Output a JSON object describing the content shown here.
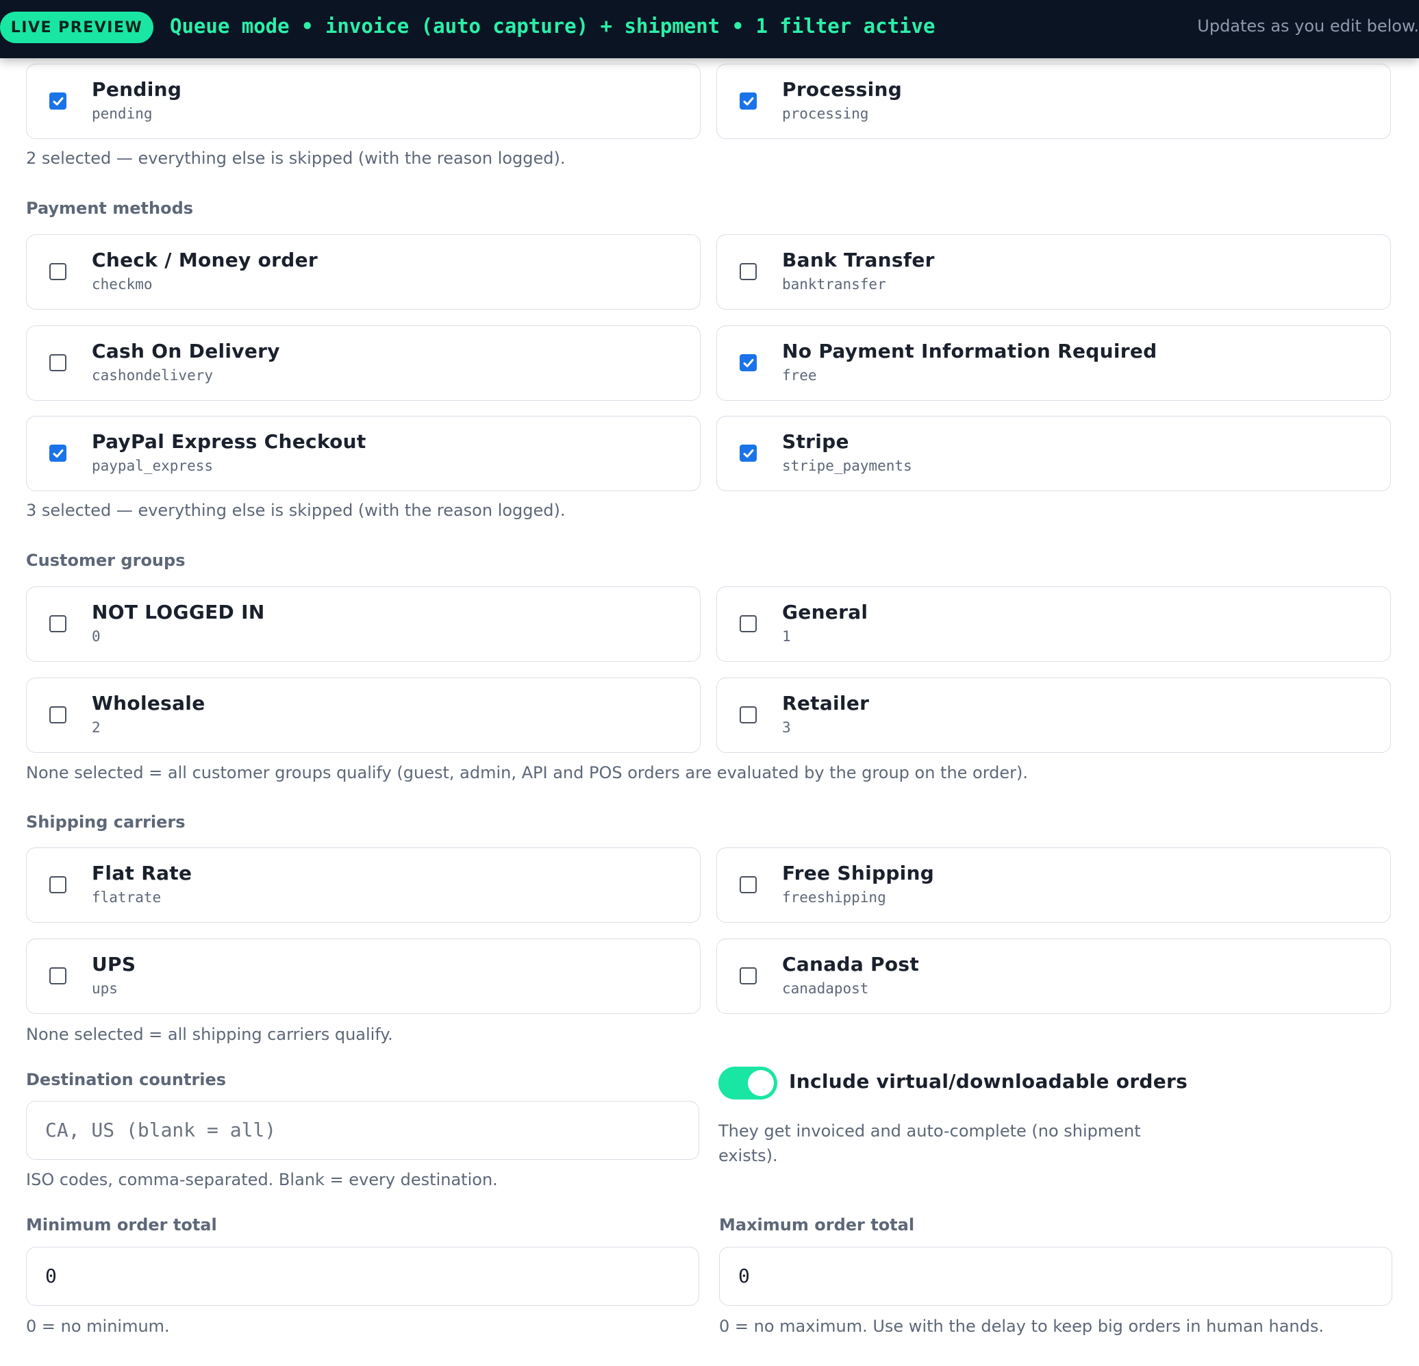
{
  "topbar": {
    "badge": "LIVE PREVIEW",
    "mode_summary": "Queue mode • invoice (auto capture) + shipment • 1 filter active",
    "updates_note": "Updates as you edit below."
  },
  "order_statuses": {
    "items": [
      {
        "title": "Pending",
        "code": "pending",
        "checked": true
      },
      {
        "title": "Processing",
        "code": "processing",
        "checked": true
      }
    ],
    "note": "2 selected — everything else is skipped (with the reason logged)."
  },
  "payment_methods": {
    "label": "Payment methods",
    "items": [
      {
        "title": "Check / Money order",
        "code": "checkmo",
        "checked": false
      },
      {
        "title": "Bank Transfer",
        "code": "banktransfer",
        "checked": false
      },
      {
        "title": "Cash On Delivery",
        "code": "cashondelivery",
        "checked": false
      },
      {
        "title": "No Payment Information Required",
        "code": "free",
        "checked": true
      },
      {
        "title": "PayPal Express Checkout",
        "code": "paypal_express",
        "checked": true
      },
      {
        "title": "Stripe",
        "code": "stripe_payments",
        "checked": true
      }
    ],
    "note": "3 selected — everything else is skipped (with the reason logged)."
  },
  "customer_groups": {
    "label": "Customer groups",
    "items": [
      {
        "title": "NOT LOGGED IN",
        "code": "0",
        "checked": false
      },
      {
        "title": "General",
        "code": "1",
        "checked": false
      },
      {
        "title": "Wholesale",
        "code": "2",
        "checked": false
      },
      {
        "title": "Retailer",
        "code": "3",
        "checked": false
      }
    ],
    "note": "None selected = all customer groups qualify (guest, admin, API and POS orders are evaluated by the group on the order)."
  },
  "shipping_carriers": {
    "label": "Shipping carriers",
    "items": [
      {
        "title": "Flat Rate",
        "code": "flatrate",
        "checked": false
      },
      {
        "title": "Free Shipping",
        "code": "freeshipping",
        "checked": false
      },
      {
        "title": "UPS",
        "code": "ups",
        "checked": false
      },
      {
        "title": "Canada Post",
        "code": "canadapost",
        "checked": false
      }
    ],
    "note": "None selected = all shipping carriers qualify."
  },
  "destination_countries": {
    "label": "Destination countries",
    "value": "",
    "placeholder": "CA, US (blank = all)",
    "note": "ISO codes, comma-separated. Blank = every destination."
  },
  "virtual_orders": {
    "label": "Include virtual/downloadable orders",
    "enabled": true,
    "help": "They get invoiced and auto-complete (no shipment exists)."
  },
  "minimum_total": {
    "label": "Minimum order total",
    "value": "0",
    "note": "0 = no minimum."
  },
  "maximum_total": {
    "label": "Maximum order total",
    "value": "0",
    "note": "0 = no maximum. Use with the delay to keep big orders in human hands."
  },
  "colors": {
    "accent": "#19e6a3",
    "checkbox": "#1a73e8",
    "topbar": "#0b1423"
  }
}
